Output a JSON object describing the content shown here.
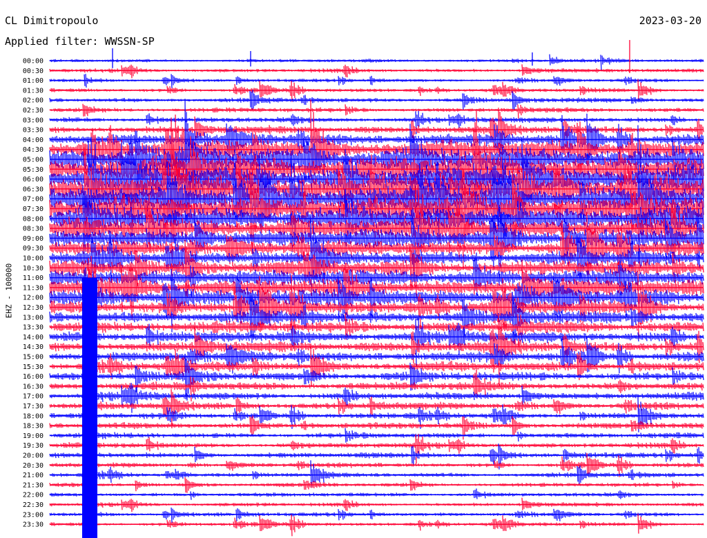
{
  "header": {
    "station": "CL Dimitropoulo",
    "date": "2023-03-20",
    "filter_text": "Applied filter: WWSSN-SP"
  },
  "chart_data": {
    "type": "line",
    "title": "CL Dimitropoulo",
    "subtitle": "Applied filter: WWSSN-SP",
    "date": "2023-03-20",
    "ylabel": "EHZ - 100000",
    "xlabel": "",
    "row_interval_minutes": 30,
    "series_colors": [
      "#0000ff",
      "#ff0033"
    ],
    "grid": false,
    "legend": "none",
    "rows": [
      {
        "label": "00:00",
        "amplitude": 0.25
      },
      {
        "label": "00:30",
        "amplitude": 0.3
      },
      {
        "label": "01:00",
        "amplitude": 0.25
      },
      {
        "label": "01:30",
        "amplitude": 0.3
      },
      {
        "label": "02:00",
        "amplitude": 0.35
      },
      {
        "label": "02:30",
        "amplitude": 0.35
      },
      {
        "label": "03:00",
        "amplitude": 0.4
      },
      {
        "label": "03:30",
        "amplitude": 0.55
      },
      {
        "label": "04:00",
        "amplitude": 0.9
      },
      {
        "label": "04:30",
        "amplitude": 1.4
      },
      {
        "label": "05:00",
        "amplitude": 1.8
      },
      {
        "label": "05:30",
        "amplitude": 2.0
      },
      {
        "label": "06:00",
        "amplitude": 2.0
      },
      {
        "label": "06:30",
        "amplitude": 2.0
      },
      {
        "label": "07:00",
        "amplitude": 1.9
      },
      {
        "label": "07:30",
        "amplitude": 1.8
      },
      {
        "label": "08:00",
        "amplitude": 1.7
      },
      {
        "label": "08:30",
        "amplitude": 1.5
      },
      {
        "label": "09:00",
        "amplitude": 1.3
      },
      {
        "label": "09:30",
        "amplitude": 1.1
      },
      {
        "label": "10:00",
        "amplitude": 1.0
      },
      {
        "label": "10:30",
        "amplitude": 1.1
      },
      {
        "label": "11:00",
        "amplitude": 1.2
      },
      {
        "label": "11:30",
        "amplitude": 1.3
      },
      {
        "label": "12:00",
        "amplitude": 1.2
      },
      {
        "label": "12:30",
        "amplitude": 1.0
      },
      {
        "label": "13:00",
        "amplitude": 0.9
      },
      {
        "label": "13:30",
        "amplitude": 0.85
      },
      {
        "label": "14:00",
        "amplitude": 0.8
      },
      {
        "label": "14:30",
        "amplitude": 0.8
      },
      {
        "label": "15:00",
        "amplitude": 0.75
      },
      {
        "label": "15:30",
        "amplitude": 0.7
      },
      {
        "label": "16:00",
        "amplitude": 0.65
      },
      {
        "label": "16:30",
        "amplitude": 0.6
      },
      {
        "label": "17:00",
        "amplitude": 0.55
      },
      {
        "label": "17:30",
        "amplitude": 0.5
      },
      {
        "label": "18:00",
        "amplitude": 0.45
      },
      {
        "label": "18:30",
        "amplitude": 0.45
      },
      {
        "label": "19:00",
        "amplitude": 0.4
      },
      {
        "label": "19:30",
        "amplitude": 0.4
      },
      {
        "label": "20:00",
        "amplitude": 0.4
      },
      {
        "label": "20:30",
        "amplitude": 0.35
      },
      {
        "label": "21:00",
        "amplitude": 0.35
      },
      {
        "label": "21:30",
        "amplitude": 0.3
      },
      {
        "label": "22:00",
        "amplitude": 0.3
      },
      {
        "label": "22:30",
        "amplitude": 0.3
      },
      {
        "label": "23:00",
        "amplitude": 0.3
      },
      {
        "label": "23:30",
        "amplitude": 0.3
      }
    ]
  }
}
